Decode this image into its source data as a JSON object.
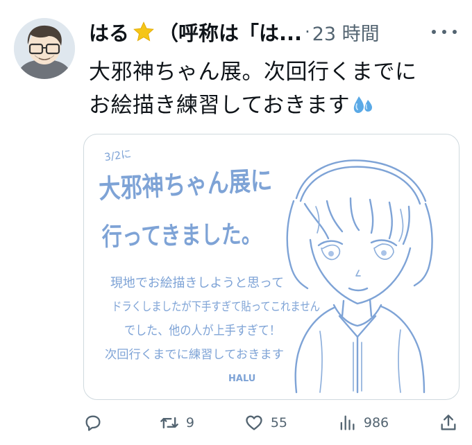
{
  "tweet": {
    "author_name": "はる",
    "handle": "（呼称は「は...",
    "separator": "·",
    "time_ago": "23 時間",
    "text_line1": "大邪神ちゃん展。次回行くまでに",
    "text_line2": "お絵描き練習しておきます"
  },
  "media": {
    "handwritten_lines": [
      "3/2に",
      "大邪神ちゃん展に",
      "行ってきました。",
      "現地でお絵描きしようと思って",
      "ドラくしましたが下手すぎて貼ってこれません",
      "でした、他の人が上手すぎて！",
      "次回行くまでに練習しておきます",
      "HALU"
    ]
  },
  "actions": {
    "replies": "",
    "retweets": "9",
    "likes": "55",
    "views": "986"
  },
  "colors": {
    "text": "#0f1419",
    "secondary": "#536471",
    "border": "#cfd9de",
    "sketch": "#7ea3d6",
    "star": "#f5c518"
  }
}
